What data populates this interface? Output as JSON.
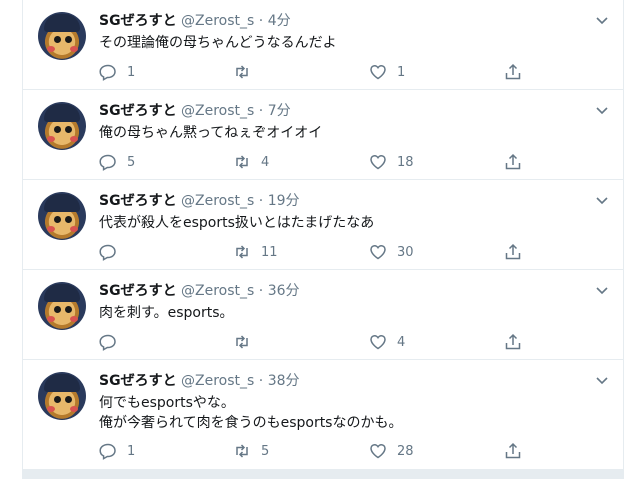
{
  "tweets": [
    {
      "name": "SGぜろすと",
      "handle": "@Zerost_s",
      "dot": "·",
      "time": "4分",
      "text": "その理論俺の母ちゃんどうなるんだよ",
      "replies": "1",
      "retweets": "",
      "likes": "1"
    },
    {
      "name": "SGぜろすと",
      "handle": "@Zerost_s",
      "dot": "·",
      "time": "7分",
      "text": "俺の母ちゃん黙ってねぇぞオイオイ",
      "replies": "5",
      "retweets": "4",
      "likes": "18"
    },
    {
      "name": "SGぜろすと",
      "handle": "@Zerost_s",
      "dot": "·",
      "time": "19分",
      "text": "代表が殺人をesports扱いとはたまげたなあ",
      "replies": "",
      "retweets": "11",
      "likes": "30"
    },
    {
      "name": "SGぜろすと",
      "handle": "@Zerost_s",
      "dot": "·",
      "time": "36分",
      "text": "肉を刺す。esports。",
      "replies": "",
      "retweets": "",
      "likes": "4"
    },
    {
      "name": "SGぜろすと",
      "handle": "@Zerost_s",
      "dot": "·",
      "time": "38分",
      "text": "何でもesportsやな。\n俺が今奢られて肉を食うのもesportsなのかも。",
      "replies": "1",
      "retweets": "5",
      "likes": "28"
    }
  ],
  "icons": {
    "reply": "reply-icon",
    "retweet": "retweet-icon",
    "like": "heart-icon",
    "share": "share-icon",
    "menu": "chevron-down-icon"
  },
  "colors": {
    "name": "#14171a",
    "meta": "#657786",
    "divider": "#e6ecf0"
  }
}
